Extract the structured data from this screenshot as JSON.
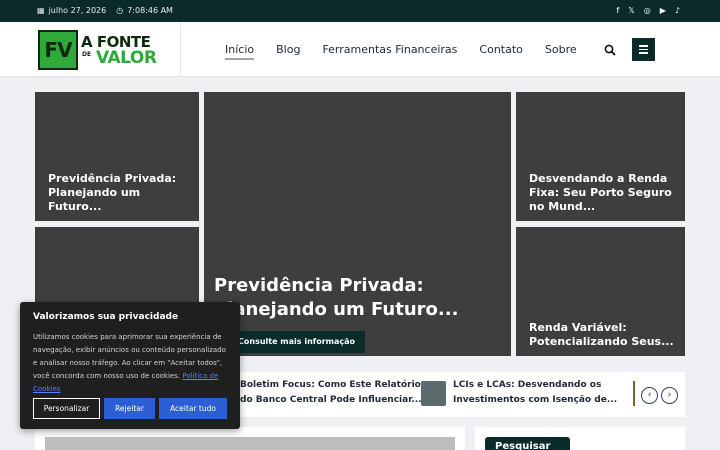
{
  "topbar": {
    "date": "julho 27, 2026",
    "time": "7:08:46 AM",
    "social": [
      "facebook-icon",
      "x-icon",
      "instagram-icon",
      "youtube-icon",
      "tiktok-icon"
    ]
  },
  "logo": {
    "fv": "FV",
    "line1": "A FONTE",
    "de": "DE",
    "line2": "VALOR"
  },
  "nav": [
    "Início",
    "Blog",
    "Ferramentas Financeiras",
    "Contato",
    "Sobre"
  ],
  "hero": {
    "left_top": "Previdência Privada: Planejando um Futuro...",
    "right_top": "Desvendando a Renda Fixa: Seu Porto Seguro no Mund...",
    "right_bottom": "Renda Variável: Potencializando Seus...",
    "big_title_l1": "Previdência Privada:",
    "big_title_l2": "Planejando um Futuro...",
    "big_button": "Consulte mais informação"
  },
  "strip": {
    "item1_l1": "Boletim Focus: Como Este Relatório",
    "item1_l2": "do Banco Central Pode Influenciar...",
    "item2_l1": "LCIs e LCAs: Desvendando os",
    "item2_l2": "Investimentos com Isenção de...",
    "prev": "‹",
    "next": "›"
  },
  "sidebar": {
    "search_tab": "Pesquisar"
  },
  "cookie": {
    "title": "Valorizamos sua privacidade",
    "text": "Utilizamos cookies para aprimorar sua experiência de navegação, exibir anúncios ou conteúdo personalizado e analisar nosso tráfego. Ao clicar em \"Aceitar todos\", você concorda com nosso uso de cookies.",
    "link": "Política de Cookies",
    "customize": "Personalizar",
    "reject": "Rejeitar",
    "accept": "Aceitar tudo"
  },
  "colors": {
    "brand_dark": "#0b2b2b",
    "brand_green": "#2faa38",
    "button_blue": "#2c5fd6"
  }
}
